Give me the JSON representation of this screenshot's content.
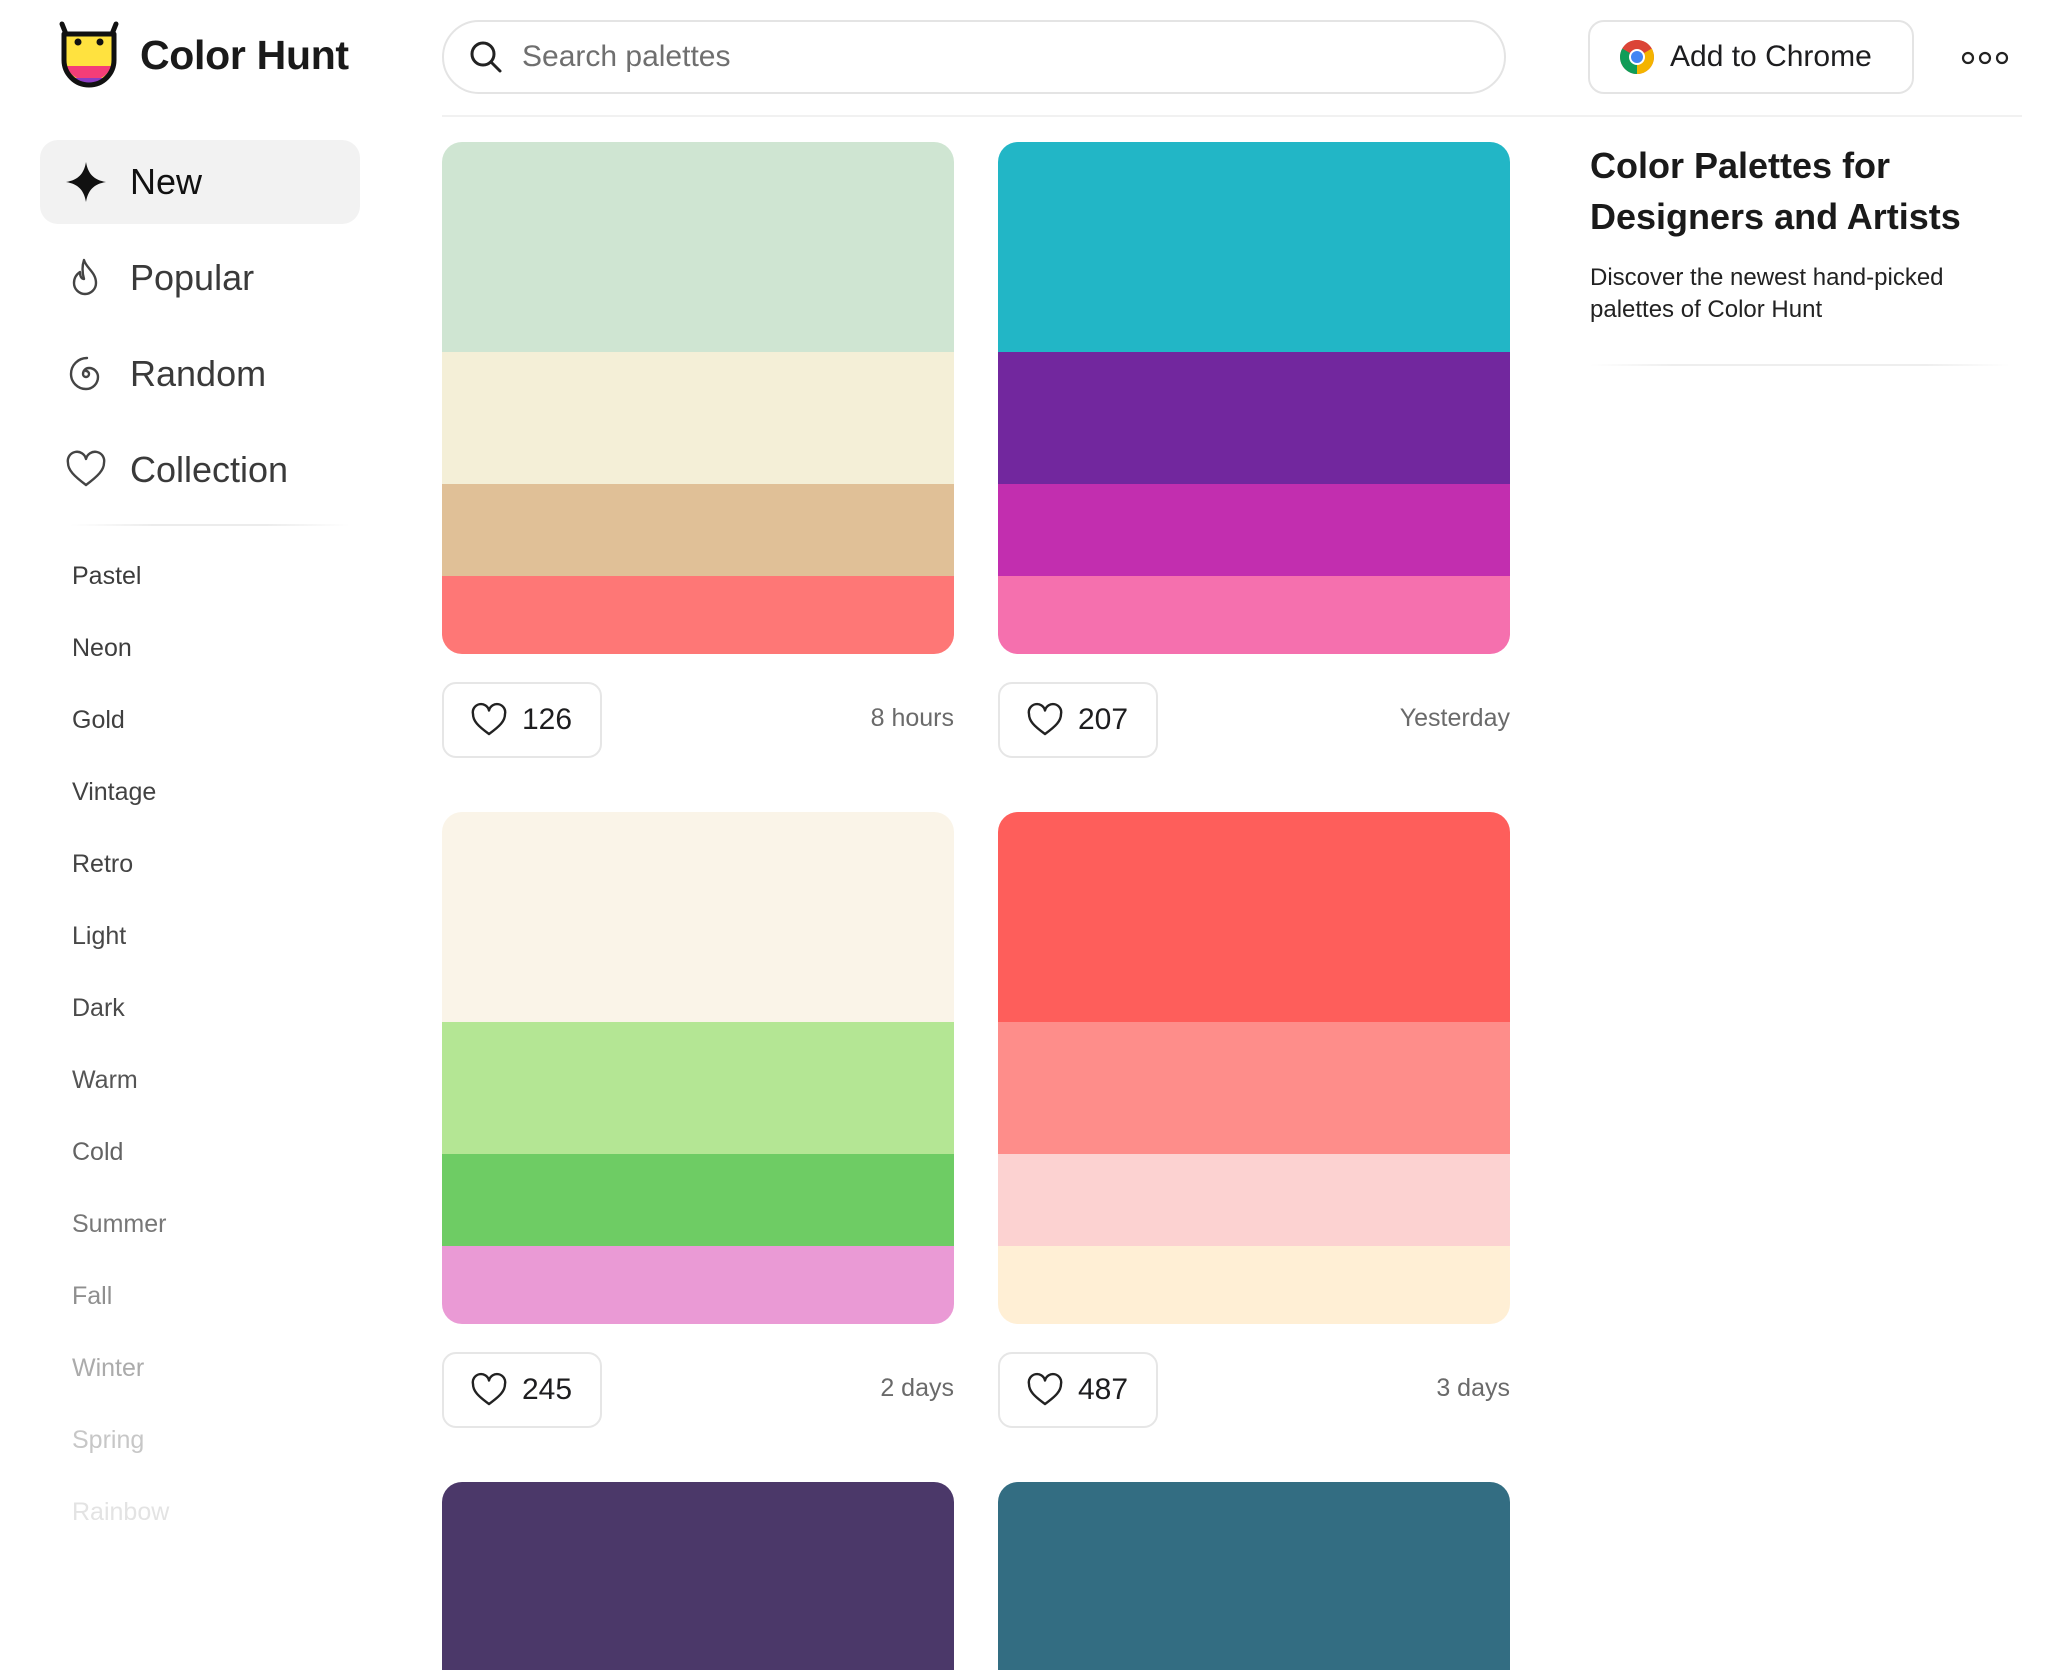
{
  "app": {
    "name": "Color Hunt"
  },
  "search": {
    "placeholder": "Search palettes"
  },
  "header": {
    "chrome_label": "Add to Chrome",
    "more_icon": "more-dots-icon"
  },
  "nav": [
    {
      "label": "New",
      "icon": "sparkle-icon",
      "active": true
    },
    {
      "label": "Popular",
      "icon": "flame-icon",
      "active": false
    },
    {
      "label": "Random",
      "icon": "spiral-icon",
      "active": false
    },
    {
      "label": "Collection",
      "icon": "heart-icon",
      "active": false
    }
  ],
  "tags": [
    "Pastel",
    "Neon",
    "Gold",
    "Vintage",
    "Retro",
    "Light",
    "Dark",
    "Warm",
    "Cold",
    "Summer",
    "Fall",
    "Winter",
    "Spring",
    "Rainbow"
  ],
  "palettes": [
    {
      "colors": [
        "#CFE5D2",
        "#F4EFD7",
        "#E0C097",
        "#FE7776"
      ],
      "likes": "126",
      "time": "8 hours"
    },
    {
      "colors": [
        "#22B6C6",
        "#72279E",
        "#C22EAF",
        "#F570AE"
      ],
      "likes": "207",
      "time": "Yesterday"
    },
    {
      "colors": [
        "#FAF4E8",
        "#B4E694",
        "#6ECC64",
        "#EA9AD5"
      ],
      "likes": "245",
      "time": "2 days"
    },
    {
      "colors": [
        "#FE5E5B",
        "#FE8D8A",
        "#FCD2D1",
        "#FFEFD5"
      ],
      "likes": "487",
      "time": "3 days"
    }
  ],
  "partial_palettes": [
    {
      "colors": [
        "#4B3869"
      ]
    },
    {
      "colors": [
        "#336D82"
      ]
    }
  ],
  "aside": {
    "title": "Color Palettes for Designers and Artists",
    "description": "Discover the newest hand-picked palettes of Color Hunt"
  }
}
